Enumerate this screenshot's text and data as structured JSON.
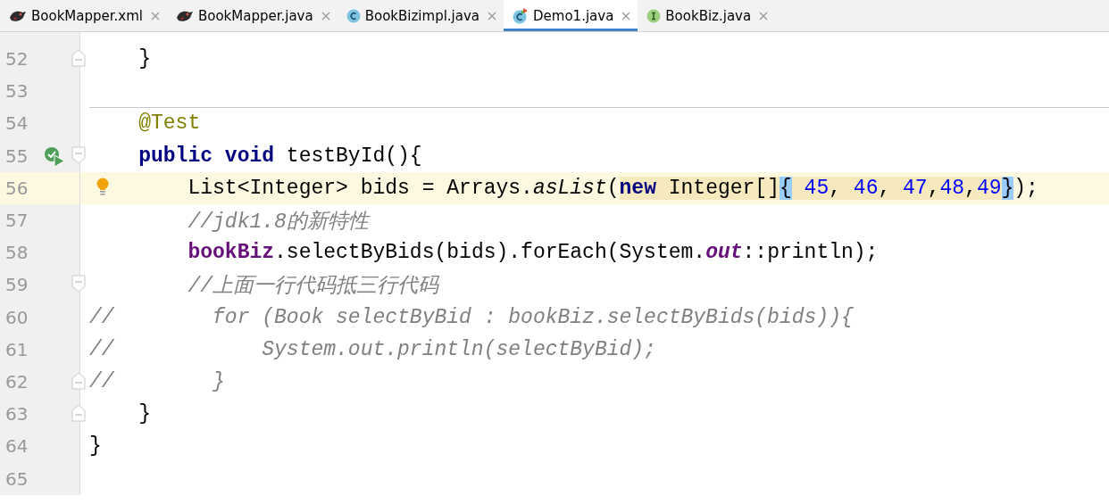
{
  "tabs": [
    {
      "label": "BookMapper.xml",
      "kind": "mapper",
      "selected": false
    },
    {
      "label": "BookMapper.java",
      "kind": "mapper",
      "selected": false
    },
    {
      "label": "BookBizimpl.java",
      "kind": "class",
      "selected": false
    },
    {
      "label": "Demo1.java",
      "kind": "test",
      "selected": true
    },
    {
      "label": "BookBiz.java",
      "kind": "interface",
      "selected": false
    }
  ],
  "lines": [
    {
      "number": "52",
      "fold_start": false,
      "fold_end": true,
      "run_marker": false,
      "bulb": false,
      "current": false,
      "separator": false,
      "tokens": [
        {
          "t": "    }",
          "kind": "plain"
        }
      ]
    },
    {
      "number": "53",
      "fold_start": false,
      "fold_end": false,
      "run_marker": false,
      "bulb": false,
      "current": false,
      "separator": false
    },
    {
      "number": "54",
      "fold_start": false,
      "fold_end": false,
      "run_marker": false,
      "bulb": false,
      "current": false,
      "separator": true,
      "tokens": [
        {
          "t": "    @Test",
          "kind": "annotation"
        }
      ]
    },
    {
      "number": "55",
      "fold_start": true,
      "fold_end": false,
      "run_marker": true,
      "bulb": false,
      "current": false,
      "separator": false,
      "tokens": [
        {
          "t": "    public void",
          "kind": "keyword"
        },
        {
          "t": " testById(){",
          "kind": "plain"
        }
      ]
    },
    {
      "number": "56",
      "fold_start": false,
      "fold_end": false,
      "run_marker": false,
      "bulb": true,
      "current": true,
      "separator": false,
      "tokens": [
        {
          "t": "        List<Integer> bids = Arrays.",
          "kind": "plain"
        },
        {
          "t": "asList",
          "kind": "static"
        },
        {
          "t": "(",
          "kind": "plain"
        },
        {
          "kind": "usage-highlight",
          "tokens": [
            {
              "t": "new",
              "kind": "keyword"
            },
            {
              "t": " Integer[]",
              "kind": "plain"
            },
            {
              "t": "{",
              "kind": "matched-brace"
            },
            {
              "t": " 45",
              "kind": "number"
            },
            {
              "t": ", ",
              "kind": "plain"
            },
            {
              "t": "46",
              "kind": "number"
            },
            {
              "t": ", ",
              "kind": "plain"
            },
            {
              "t": "47",
              "kind": "number"
            },
            {
              "t": ",",
              "kind": "plain"
            },
            {
              "t": "48",
              "kind": "number"
            },
            {
              "t": ",",
              "kind": "plain"
            },
            {
              "t": "49",
              "kind": "number"
            },
            {
              "t": "}",
              "kind": "matched-brace"
            }
          ]
        },
        {
          "t": ");",
          "kind": "plain"
        }
      ]
    },
    {
      "number": "57",
      "fold_start": false,
      "fold_end": false,
      "run_marker": false,
      "bulb": false,
      "current": false,
      "separator": false,
      "tokens": [
        {
          "t": "        //jdk1.8的新特性",
          "kind": "comment"
        }
      ]
    },
    {
      "number": "58",
      "fold_start": false,
      "fold_end": false,
      "run_marker": false,
      "bulb": false,
      "current": false,
      "separator": false,
      "tokens": [
        {
          "t": "        bookBiz",
          "kind": "member"
        },
        {
          "t": ".selectByBids(bids).forEach(System.",
          "kind": "plain"
        },
        {
          "t": "out",
          "kind": "static-field"
        },
        {
          "t": "::println);",
          "kind": "plain"
        }
      ]
    },
    {
      "number": "59",
      "fold_start": true,
      "fold_end": false,
      "run_marker": false,
      "bulb": false,
      "current": false,
      "separator": false,
      "tokens": [
        {
          "t": "        //上面一行代码抵三行代码",
          "kind": "comment"
        }
      ]
    },
    {
      "number": "60",
      "fold_start": false,
      "fold_end": false,
      "run_marker": false,
      "bulb": false,
      "current": false,
      "separator": false,
      "tokens": [
        {
          "t": "//        for (Book selectByBid : bookBiz.selectByBids(bids)){",
          "kind": "comment"
        }
      ]
    },
    {
      "number": "61",
      "fold_start": false,
      "fold_end": false,
      "run_marker": false,
      "bulb": false,
      "current": false,
      "separator": false,
      "tokens": [
        {
          "t": "//            System.out.println(selectByBid);",
          "kind": "comment"
        }
      ]
    },
    {
      "number": "62",
      "fold_start": false,
      "fold_end": true,
      "run_marker": false,
      "bulb": false,
      "current": false,
      "separator": false,
      "tokens": [
        {
          "t": "//        }",
          "kind": "comment"
        }
      ]
    },
    {
      "number": "63",
      "fold_start": false,
      "fold_end": true,
      "run_marker": false,
      "bulb": false,
      "current": false,
      "separator": false,
      "tokens": [
        {
          "t": "    }",
          "kind": "plain"
        }
      ]
    },
    {
      "number": "64",
      "fold_start": false,
      "fold_end": false,
      "run_marker": false,
      "bulb": false,
      "current": false,
      "separator": false,
      "tokens": [
        {
          "t": "}",
          "kind": "plain"
        }
      ]
    },
    {
      "number": "65",
      "fold_start": false,
      "fold_end": false,
      "run_marker": false,
      "bulb": false,
      "current": false,
      "separator": false
    }
  ]
}
